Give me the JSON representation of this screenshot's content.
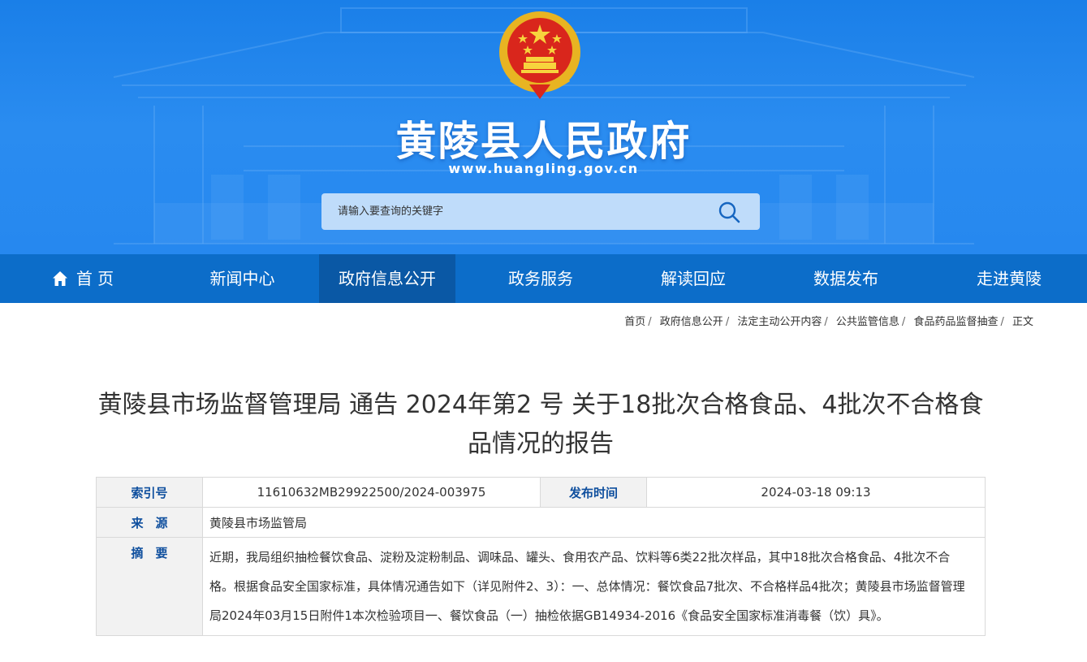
{
  "header": {
    "site_name": "黄陵县人民政府",
    "site_url": "www.huangling.gov.cn",
    "emblem": "national-emblem",
    "colors": {
      "banner": "#2688ef",
      "nav": "#0c6dc9",
      "nav_active": "#0a58a5",
      "label_text": "#0f4f9e"
    }
  },
  "search": {
    "placeholder": "请输入要查询的关键字",
    "icon": "search-icon"
  },
  "nav": {
    "items": [
      {
        "label": "首 页",
        "icon": "home-icon"
      },
      {
        "label": "新闻中心"
      },
      {
        "label": "政府信息公开",
        "active": true
      },
      {
        "label": "政务服务"
      },
      {
        "label": "解读回应"
      },
      {
        "label": "数据发布"
      },
      {
        "label": "走进黄陵"
      }
    ]
  },
  "breadcrumb": {
    "items": [
      "首页",
      "政府信息公开",
      "法定主动公开内容",
      "公共监管信息",
      "食品药品监督抽查",
      "正文"
    ],
    "separator": "/"
  },
  "article": {
    "title": "黄陵县市场监督管理局 通告 2024年第2 号 关于18批次合格食品、4批次不合格食品情况的报告"
  },
  "info_table": {
    "index_label": "索引号",
    "index_value": "11610632MB29922500/2024-003975",
    "publish_label": "发布时间",
    "publish_value": "2024-03-18 09:13",
    "source_label": "来　源",
    "source_value": "黄陵县市场监管局",
    "summary_label": "摘　要",
    "summary_value": "近期，我局组织抽检餐饮食品、淀粉及淀粉制品、调味品、罐头、食用农产品、饮料等6类22批次样品，其中18批次合格食品、4批次不合格。根据食品安全国家标准，具体情况通告如下（详见附件2、3）：一、总体情况：餐饮食品7批次、不合格样品4批次；黄陵县市场监督管理局2024年03月15日附件1本次检验项目一、餐饮食品（一）抽检依据GB14934-2016《食品安全国家标准消毒餐（饮）具》。"
  }
}
